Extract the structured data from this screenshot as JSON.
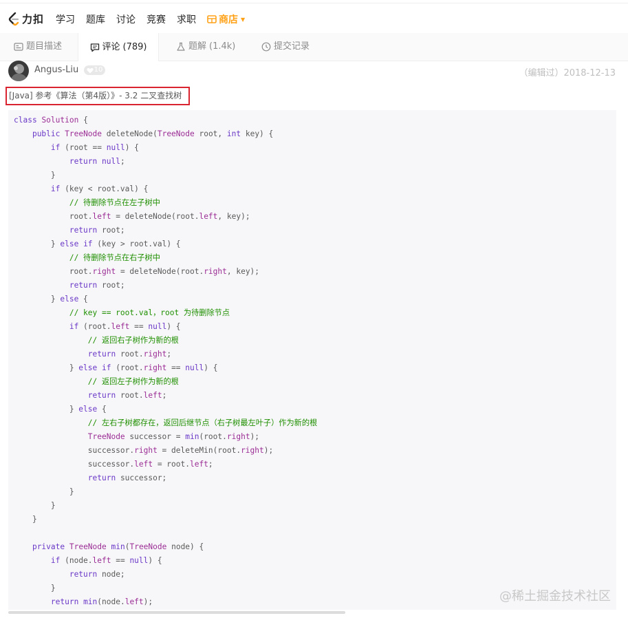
{
  "brand": {
    "name": "力扣"
  },
  "nav": {
    "items": [
      "学习",
      "题库",
      "讨论",
      "竞赛",
      "求职"
    ],
    "store": "商店"
  },
  "tabs": [
    {
      "label": "题目描述",
      "count": ""
    },
    {
      "label": "评论",
      "count": "(789)"
    },
    {
      "label": "题解",
      "count": "(1.4k)"
    },
    {
      "label": "提交记录",
      "count": ""
    }
  ],
  "comment": {
    "author": "Angus-Liu",
    "badge": "10",
    "edited": "（编辑过）2018-12-13",
    "title": "[Java] 参考《算法（第4版）》- 3.2 二叉查找树"
  },
  "code_lines": [
    "<span class=\"kw\">class</span> <span class=\"ty\">Solution</span> {",
    "    <span class=\"kw\">public</span> <span class=\"ty\">TreeNode</span> deleteNode(<span class=\"ty\">TreeNode</span> root, <span class=\"kw\">int</span> key) {",
    "        <span class=\"kw\">if</span> (root == <span class=\"kw\">null</span>) {",
    "            <span class=\"kw\">return</span> <span class=\"kw\">null</span>;",
    "        }",
    "        <span class=\"kw\">if</span> (key &lt; root.val) {",
    "            <span class=\"cm\">// 待删除节点在左子树中</span>",
    "            root.<span class=\"pr\">left</span> = deleteNode(root.<span class=\"pr\">left</span>, key);",
    "            <span class=\"kw\">return</span> root;",
    "        } <span class=\"kw\">else</span> <span class=\"kw\">if</span> (key &gt; root.val) {",
    "            <span class=\"cm\">// 待删除节点在右子树中</span>",
    "            root.<span class=\"pr\">right</span> = deleteNode(root.<span class=\"pr\">right</span>, key);",
    "            <span class=\"kw\">return</span> root;",
    "        } <span class=\"kw\">else</span> {",
    "            <span class=\"cm\">// key == root.val，root 为待删除节点</span>",
    "            <span class=\"kw\">if</span> (root.<span class=\"pr\">left</span> == <span class=\"kw\">null</span>) {",
    "                <span class=\"cm\">// 返回右子树作为新的根</span>",
    "                <span class=\"kw\">return</span> root.<span class=\"pr\">right</span>;",
    "            } <span class=\"kw\">else</span> <span class=\"kw\">if</span> (root.<span class=\"pr\">right</span> == <span class=\"kw\">null</span>) {",
    "                <span class=\"cm\">// 返回左子树作为新的根</span>",
    "                <span class=\"kw\">return</span> root.<span class=\"pr\">left</span>;",
    "            } <span class=\"kw\">else</span> {",
    "                <span class=\"cm\">// 左右子树都存在，返回后继节点（右子树最左叶子）作为新的根</span>",
    "                <span class=\"ty\">TreeNode</span> successor = <span class=\"kw\">min</span>(root.<span class=\"pr\">right</span>);",
    "                successor.<span class=\"pr\">right</span> = deleteMin(root.<span class=\"pr\">right</span>);",
    "                successor.<span class=\"pr\">left</span> = root.<span class=\"pr\">left</span>;",
    "                <span class=\"kw\">return</span> successor;",
    "            }",
    "        }",
    "    }",
    "",
    "    <span class=\"kw\">private</span> <span class=\"ty\">TreeNode</span> <span class=\"kw\">min</span>(<span class=\"ty\">TreeNode</span> node) {",
    "        <span class=\"kw\">if</span> (node.<span class=\"pr\">left</span> == <span class=\"kw\">null</span>) {",
    "            <span class=\"kw\">return</span> node;",
    "        }",
    "        <span class=\"kw\">return</span> <span class=\"kw\">min</span>(node.<span class=\"pr\">left</span>);"
  ],
  "watermark": "@稀土掘金技术社区",
  "colors": {
    "accent": "#ffa116",
    "highlight_border": "#d9232e",
    "code_bg": "#f7f7f9",
    "keyword": "#6a38c7",
    "comment": "#1f8f00"
  }
}
